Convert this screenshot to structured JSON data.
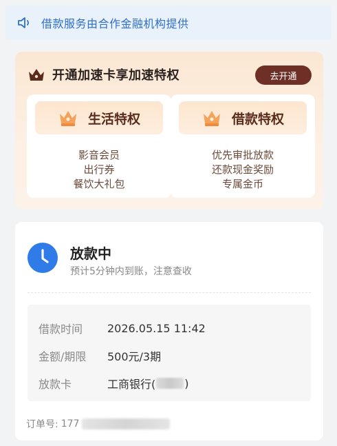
{
  "notice": {
    "text": "借款服务由合作金融机构提供",
    "icon": "speaker-icon",
    "color": "#2f6fc8"
  },
  "promo": {
    "title": "开通加速卡享加速特权",
    "button_label": "去开通",
    "perks": [
      {
        "title": "生活特权",
        "items": [
          "影音会员",
          "出行券",
          "餐饮大礼包"
        ]
      },
      {
        "title": "借款特权",
        "items": [
          "优先审批放款",
          "还款现金奖励",
          "专属金币"
        ]
      }
    ]
  },
  "status": {
    "title": "放款中",
    "subtitle": "预计5分钟内到账，注意查收",
    "icon": "clock-icon",
    "details": [
      {
        "label": "借款时间",
        "value": "2026.05.15 11:42"
      },
      {
        "label": "金额/期限",
        "value": "500元/3期"
      },
      {
        "label": "放款卡",
        "value_prefix": "工商银行(",
        "value_suffix": ")"
      }
    ],
    "order_label": "订单号:",
    "order_prefix": "177"
  },
  "colors": {
    "accent_blue": "#2f6fc8",
    "promo_button": "#6e2f27",
    "perk_title": "#5a2c1c"
  }
}
